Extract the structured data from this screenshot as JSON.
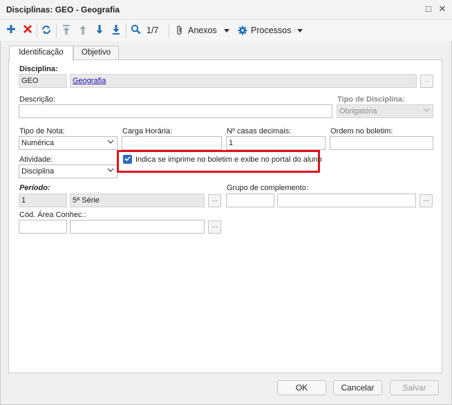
{
  "window": {
    "title": "Disciplinas: GEO - Geografia",
    "restore_glyph": "□",
    "close_glyph": "✕"
  },
  "toolbar": {
    "icons": [
      "plus-icon",
      "delete-icon",
      "refresh-icon",
      "first-record-icon",
      "previous-record-icon",
      "next-record-icon",
      "last-record-icon",
      "search-icon"
    ],
    "record_position": "1/7",
    "anexos_label": "Anexos",
    "processos_label": "Processos"
  },
  "tabs": [
    {
      "label": "Identificação",
      "active": true
    },
    {
      "label": "Objetivo",
      "active": false
    }
  ],
  "form": {
    "disciplina_label": "Disciplina:",
    "disciplina_code": "GEO",
    "disciplina_name": "Geografia",
    "descricao_label": "Descrição:",
    "descricao_value": "",
    "tipo_disciplina_label": "Tipo de Disciplina:",
    "tipo_disciplina_value": "Obrigatória",
    "tipo_nota_label": "Tipo de Nota:",
    "tipo_nota_value": "Numérica",
    "carga_horaria_label": "Carga Horária:",
    "carga_horaria_value": "",
    "casas_decimais_label": "Nº casas decimais:",
    "casas_decimais_value": "1",
    "ordem_boletim_label": "Ordem no boletim:",
    "ordem_boletim_value": "",
    "atividade_label": "Atividade:",
    "atividade_value": "Disciplina",
    "imprime_checkbox_label": "Indica se imprime no boletim e exibe no portal do aluno",
    "imprime_checked": true,
    "periodo_label": "Período:",
    "periodo_code": "1",
    "periodo_name": "5ª Série",
    "grupo_complemento_label": "Grupo de complemento:",
    "grupo_code": "",
    "grupo_name": "",
    "cod_area_label": "Cód. Área Conhec.:",
    "cod_area_code": "",
    "cod_area_name": "",
    "lookup_glyph": "..."
  },
  "buttons": {
    "ok": "OK",
    "cancel": "Cancelar",
    "save": "Salvar"
  },
  "colors": {
    "accent": "#1f6fb5",
    "delete": "#d62a2a",
    "highlight_border": "#e0141e",
    "checkbox": "#2c6fbd"
  }
}
